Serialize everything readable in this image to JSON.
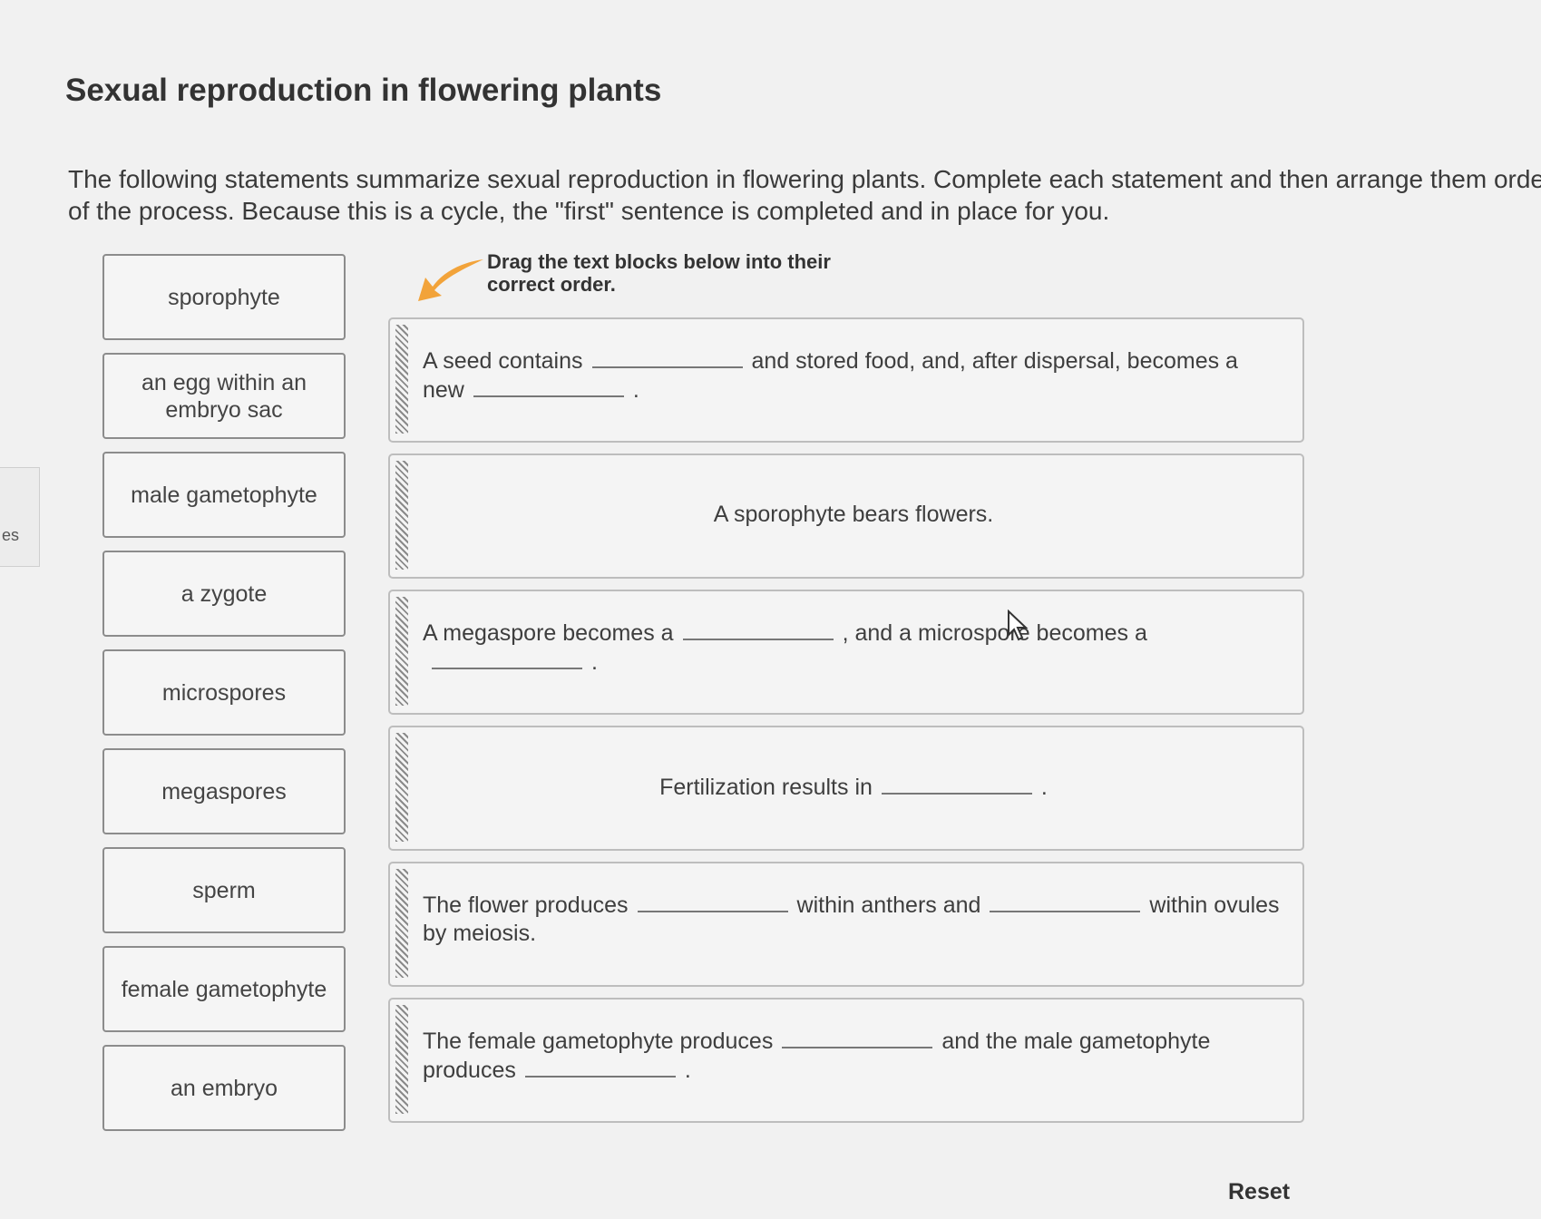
{
  "side_tab": {
    "label": "es"
  },
  "header": {
    "title": "Sexual reproduction in flowering plants",
    "instructions": "The following statements summarize sexual reproduction in flowering plants. Complete each statement and then arrange them order of the process. Because this is a cycle, the \"first\" sentence is completed and in place for you.",
    "drag_hint": "Drag the text blocks below into their correct order."
  },
  "word_bank": [
    {
      "label": "sporophyte"
    },
    {
      "label": "an egg within an embryo sac"
    },
    {
      "label": "male gametophyte"
    },
    {
      "label": "a zygote"
    },
    {
      "label": "microspores"
    },
    {
      "label": "megaspores"
    },
    {
      "label": "sperm"
    },
    {
      "label": "female gametophyte"
    },
    {
      "label": "an embryo"
    }
  ],
  "statements": [
    {
      "p1": "A seed contains",
      "p2": "and stored food, and, after dispersal, becomes a new",
      "p3": "."
    },
    {
      "text": "A sporophyte bears flowers."
    },
    {
      "p1": "A megaspore becomes a",
      "p2": ", and a microspore becomes a",
      "p3": "."
    },
    {
      "p1": "Fertilization results in",
      "p2": "."
    },
    {
      "p1": "The flower produces",
      "p2": "within anthers and",
      "p3": "within ovules by meiosis."
    },
    {
      "p1": "The female gametophyte produces",
      "p2": "and the male gametophyte produces",
      "p3": "."
    }
  ],
  "footer": {
    "reset_label": "Reset"
  },
  "colors": {
    "arrow": "#f2a33a",
    "block_border": "#8c8c8c",
    "text": "#3e3e3e"
  }
}
